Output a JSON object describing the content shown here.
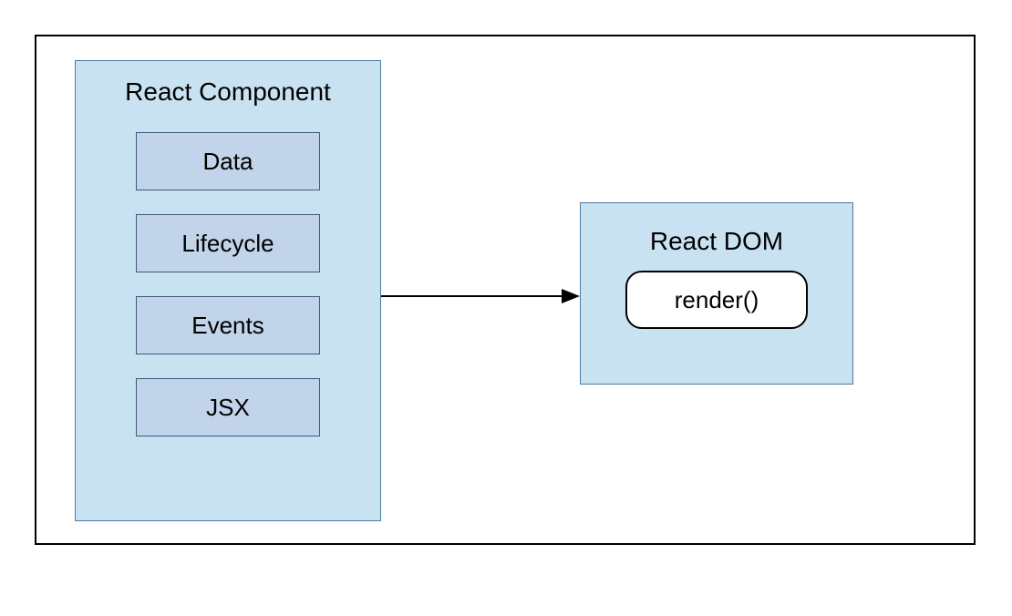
{
  "component": {
    "title": "React Component",
    "items": [
      "Data",
      "Lifecycle",
      "Events",
      "JSX"
    ]
  },
  "dom": {
    "title": "React DOM",
    "method": "render()"
  }
}
